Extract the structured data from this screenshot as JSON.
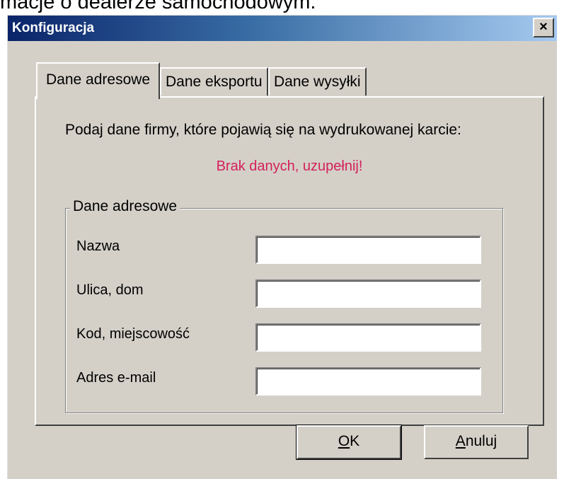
{
  "background_caption": "macje o dealerze samochodowym.",
  "window": {
    "title": "Konfiguracja",
    "close_glyph": "×",
    "titlebar_colors": [
      "#0a246a",
      "#a6caf0"
    ]
  },
  "tabs": [
    {
      "label": "Dane adresowe",
      "active": true
    },
    {
      "label": "Dane eksportu",
      "active": false
    },
    {
      "label": "Dane wysyłki",
      "active": false
    }
  ],
  "panel": {
    "instruction": "Podaj dane firmy, które pojawią się na wydrukowanej karcie:",
    "error": "Brak danych, uzupełnij!",
    "error_color": "#d3215a",
    "group_title": "Dane adresowe",
    "fields": [
      {
        "label": "Nazwa",
        "value": ""
      },
      {
        "label": "Ulica, dom",
        "value": ""
      },
      {
        "label": "Kod, miejscowość",
        "value": ""
      },
      {
        "label": "Adres e-mail",
        "value": ""
      }
    ]
  },
  "buttons": {
    "ok": {
      "mnemonic": "O",
      "rest": "K"
    },
    "cancel": {
      "mnemonic": "A",
      "rest": "nuluj"
    }
  }
}
